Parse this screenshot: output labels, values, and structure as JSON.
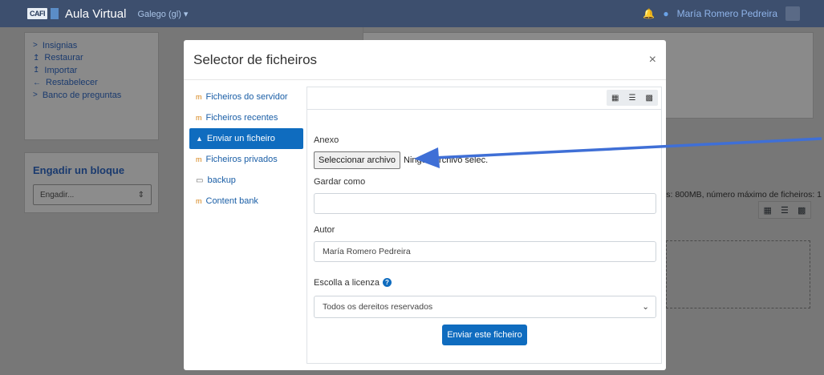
{
  "navbar": {
    "logo_text": "CAFI",
    "site_name": "Aula Virtual",
    "language": "Galego (gl) ▾",
    "user_name": "María Romero Pedreira"
  },
  "background": {
    "left_menu": [
      {
        "icon": ">",
        "label": "Insignias"
      },
      {
        "icon": "↥",
        "label": "Restaurar"
      },
      {
        "icon": "↥",
        "label": "Importar"
      },
      {
        "icon": "←",
        "label": "Restabelecer"
      },
      {
        "icon": ">",
        "label": "Banco de preguntas"
      }
    ],
    "add_block_title": "Engadir un bloque",
    "add_block_select": "Engadir...",
    "info_text": "s: 800MB, número máximo de ficheiros: 1"
  },
  "modal": {
    "title": "Selector de ficheiros",
    "close": "×",
    "repositories": [
      {
        "label": "Ficheiros do servidor",
        "icon": "m",
        "active": false
      },
      {
        "label": "Ficheiros recentes",
        "icon": "m",
        "active": false
      },
      {
        "label": "Enviar un ficheiro",
        "icon": "▲",
        "active": true
      },
      {
        "label": "Ficheiros privados",
        "icon": "m",
        "active": false
      },
      {
        "label": "backup",
        "icon": "▭",
        "active": false
      },
      {
        "label": "Content bank",
        "icon": "m",
        "active": false
      }
    ],
    "form": {
      "attachment_label": "Anexo",
      "file_button": "Seleccionar archivo",
      "file_status": "Ningún archivo selec.",
      "save_as_label": "Gardar como",
      "save_as_value": "",
      "author_label": "Autor",
      "author_value": "María Romero Pedreira",
      "license_label": "Escolla a licenza",
      "license_value": "Todos os dereitos reservados",
      "submit": "Enviar este ficheiro"
    }
  },
  "colors": {
    "primary": "#0f6cbf",
    "navbar": "#3d4f6e",
    "arrow": "#3f6fd6"
  }
}
